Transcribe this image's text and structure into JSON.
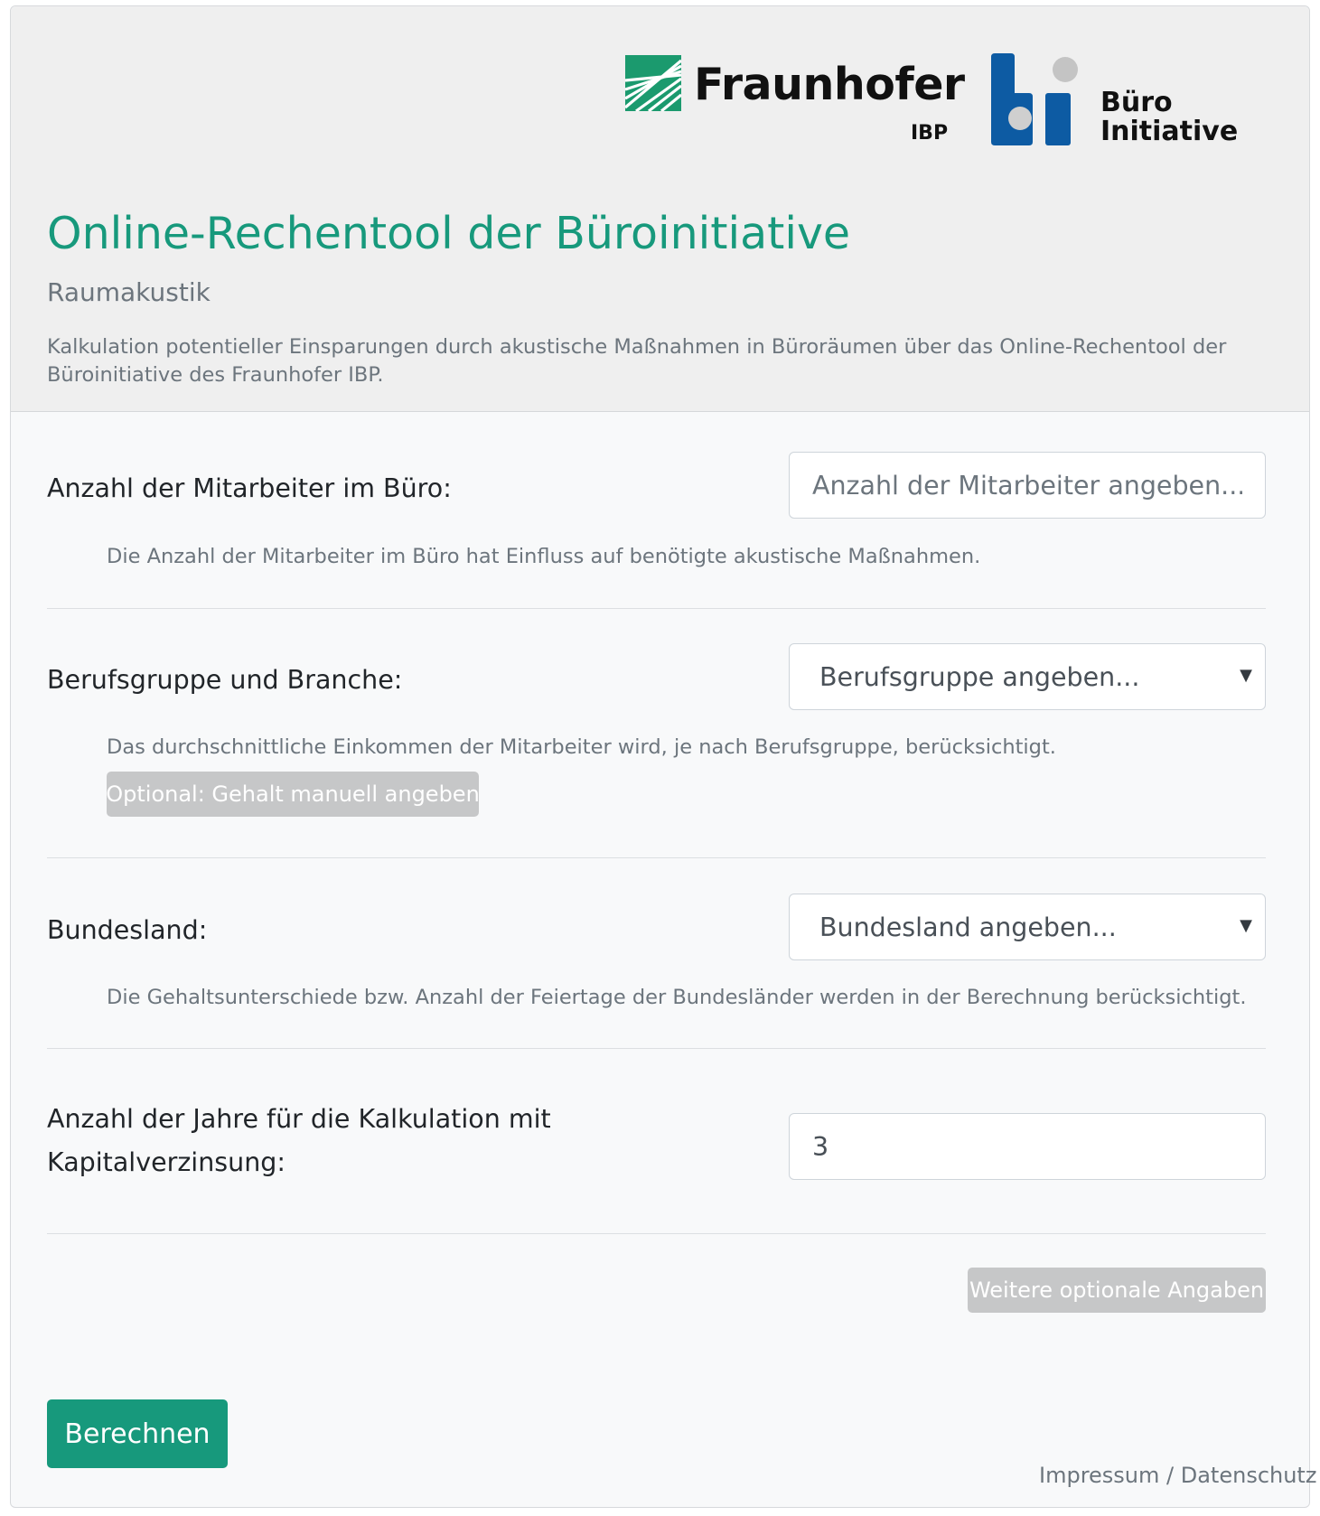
{
  "header": {
    "logo_fraunhofer": {
      "name": "Fraunhofer",
      "sub": "IBP"
    },
    "logo_buero": {
      "line1": "Büro",
      "line2": "Initiative"
    },
    "title": "Online-Rechentool der Büroinitiative",
    "subtitle": "Raumakustik",
    "lead": "Kalkulation potentieller Einsparungen durch akustische Maßnahmen in Büroräumen über das Online-Rechentool der Büroinitiative des Fraunhofer IBP."
  },
  "form": {
    "employees": {
      "label": "Anzahl der Mitarbeiter im Büro:",
      "placeholder": "Anzahl der Mitarbeiter angeben...",
      "value": "",
      "help": "Die Anzahl der Mitarbeiter im Büro hat Einfluss auf benötigte akustische Maßnahmen."
    },
    "profession": {
      "label": "Berufsgruppe und Branche:",
      "selected": "Berufsgruppe angeben...",
      "help": "Das durchschnittliche Einkommen der Mitarbeiter wird, je nach Berufsgruppe, berücksichtigt.",
      "optional_button": "Optional: Gehalt manuell angeben"
    },
    "state": {
      "label": "Bundesland:",
      "selected": "Bundesland angeben...",
      "help": "Die Gehaltsunterschiede bzw. Anzahl der Feiertage der Bundesländer werden in der Berechnung berücksichtigt."
    },
    "years": {
      "label_line1": "Anzahl der Jahre für die Kalkulation mit",
      "label_line2": "Kapitalverzinsung:",
      "value": "3"
    },
    "more_button": "Weitere optionale Angaben",
    "submit_button": "Berechnen"
  },
  "footer": {
    "link": "Impressum / Datenschutz"
  },
  "colors": {
    "accent": "#17997c",
    "fraunhofer_green": "#1b9a6e",
    "buero_blue": "#0d5ba3"
  },
  "icons": {
    "select_caret": "caret-down-icon"
  }
}
